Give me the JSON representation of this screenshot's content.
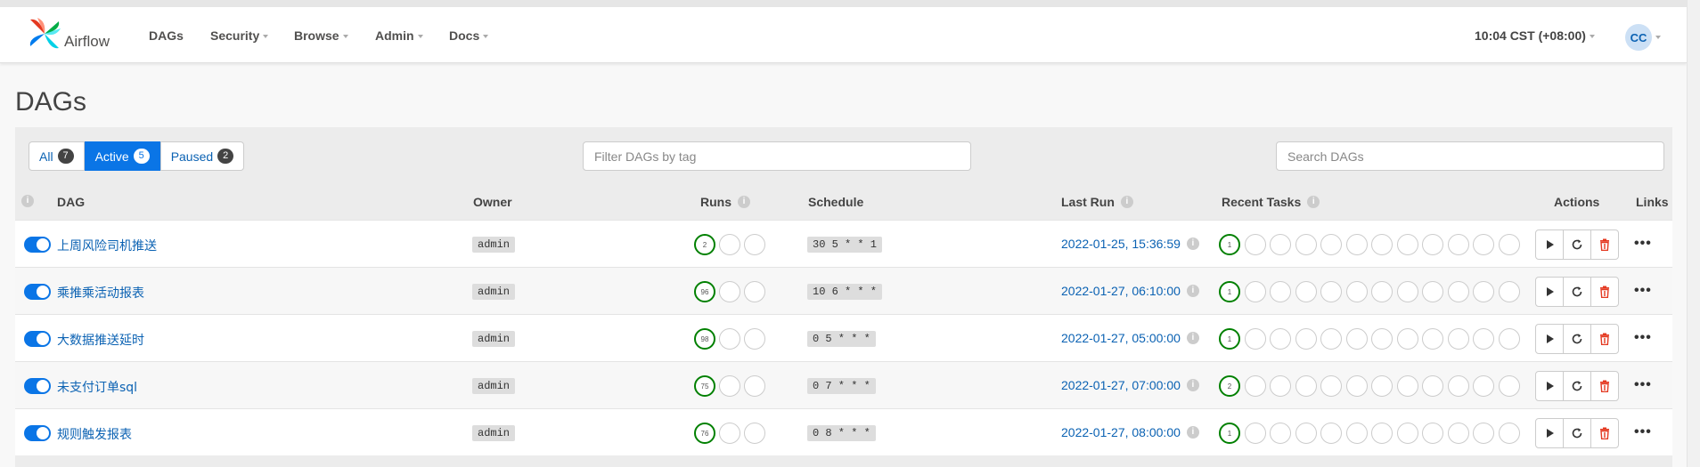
{
  "app": {
    "brand": "Airflow"
  },
  "nav": {
    "items": [
      {
        "label": "DAGs",
        "dropdown": false
      },
      {
        "label": "Security",
        "dropdown": true
      },
      {
        "label": "Browse",
        "dropdown": true
      },
      {
        "label": "Admin",
        "dropdown": true
      },
      {
        "label": "Docs",
        "dropdown": true
      }
    ],
    "clock": "10:04 CST (+08:00)",
    "user_initials": "CC"
  },
  "page": {
    "title": "DAGs"
  },
  "filters": {
    "tabs": [
      {
        "label": "All",
        "count": "7",
        "active": false
      },
      {
        "label": "Active",
        "count": "5",
        "active": true
      },
      {
        "label": "Paused",
        "count": "2",
        "active": false
      }
    ],
    "tag_placeholder": "Filter DAGs by tag",
    "search_placeholder": "Search DAGs"
  },
  "table": {
    "headers": {
      "dag": "DAG",
      "owner": "Owner",
      "runs": "Runs",
      "schedule": "Schedule",
      "last_run": "Last Run",
      "recent_tasks": "Recent Tasks",
      "actions": "Actions",
      "links": "Links"
    },
    "rows": [
      {
        "name": "上周风险司机推送",
        "owner": "admin",
        "runs": [
          "2",
          "",
          ""
        ],
        "schedule": "30 5 * * 1",
        "last_run": "2022-01-25, 15:36:59",
        "recent_first": "1",
        "enabled": true
      },
      {
        "name": "乘推乘活动报表",
        "owner": "admin",
        "runs": [
          "96",
          "",
          ""
        ],
        "schedule": "10 6 * * *",
        "last_run": "2022-01-27, 06:10:00",
        "recent_first": "1",
        "enabled": true
      },
      {
        "name": "大数据推送延时",
        "owner": "admin",
        "runs": [
          "98",
          "",
          ""
        ],
        "schedule": "0 5 * * *",
        "last_run": "2022-01-27, 05:00:00",
        "recent_first": "1",
        "enabled": true
      },
      {
        "name": "未支付订单sql",
        "owner": "admin",
        "runs": [
          "75",
          "",
          ""
        ],
        "schedule": "0 7 * * *",
        "last_run": "2022-01-27, 07:00:00",
        "recent_first": "2",
        "enabled": true
      },
      {
        "name": "规则触发报表",
        "owner": "admin",
        "runs": [
          "76",
          "",
          ""
        ],
        "schedule": "0 8 * * *",
        "last_run": "2022-01-27, 08:00:00",
        "recent_first": "1",
        "enabled": true
      }
    ]
  },
  "icons": {
    "info": "info-icon",
    "trigger": "play-icon",
    "refresh": "refresh-icon",
    "delete": "trash-icon",
    "more": "ellipsis-icon"
  },
  "colors": {
    "primary": "#0a75e6",
    "success": "#008000",
    "delete": "#e43921"
  },
  "glyphs": {
    "info": "i",
    "more": "•••"
  }
}
